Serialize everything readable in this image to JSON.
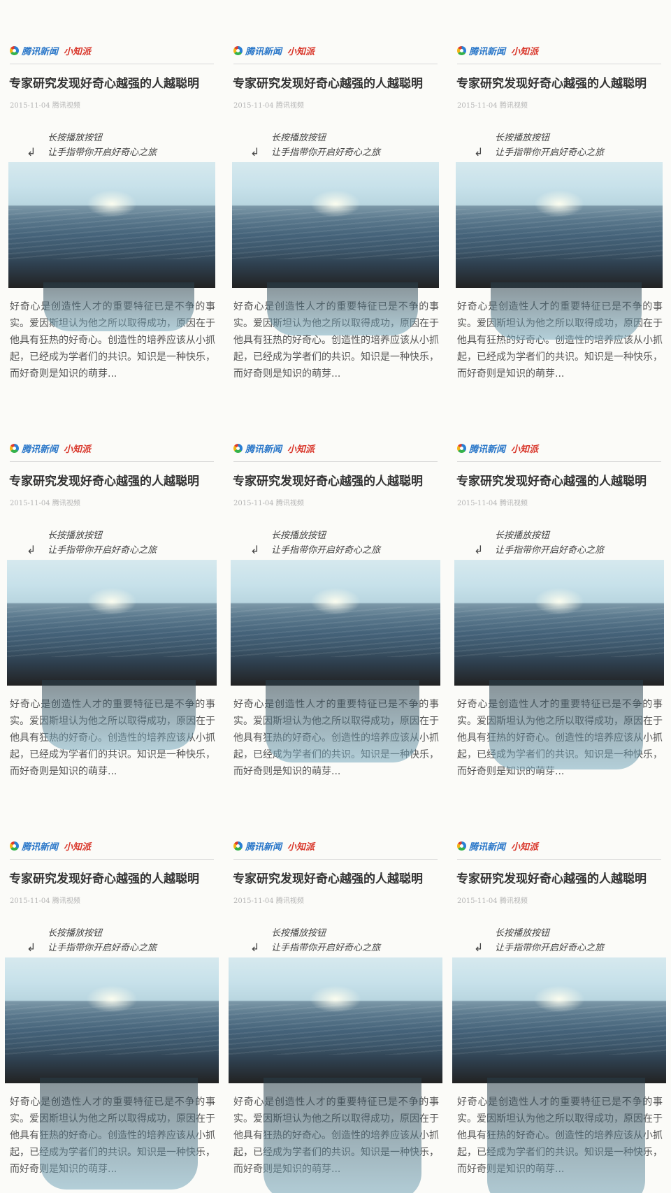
{
  "panels": [
    {
      "brand": "腾讯新闻",
      "tag": "小知派",
      "title": "专家研究发现好奇心越强的人越聪明",
      "meta": "2015-11-04 腾讯视频",
      "hint_line1": "长按播放按钮",
      "hint_line2": "让手指带你开启好奇心之旅",
      "article": "好奇心是创造性人才的重要特征已是不争的事实。爱因斯坦认为他之所以取得成功，原因在于他具有狂热的好奇心。创造性的培养应该从小抓起，已经成为学者们的共识。知识是一种快乐，而好奇则是知识的萌芽..."
    },
    {
      "brand": "腾讯新闻",
      "tag": "小知派",
      "title": "专家研究发现好奇心越强的人越聪明",
      "meta": "2015-11-04 腾讯视频",
      "hint_line1": "长按播放按钮",
      "hint_line2": "让手指带你开启好奇心之旅",
      "article": "好奇心是创造性人才的重要特征已是不争的事实。爱因斯坦认为他之所以取得成功，原因在于他具有狂热的好奇心。创造性的培养应该从小抓起，已经成为学者们的共识。知识是一种快乐，而好奇则是知识的萌芽..."
    },
    {
      "brand": "腾讯新闻",
      "tag": "小知派",
      "title": "专家研究发现好奇心越强的人越聪明",
      "meta": "2015-11-04 腾讯视频",
      "hint_line1": "长按播放按钮",
      "hint_line2": "让手指带你开启好奇心之旅",
      "article": "好奇心是创造性人才的重要特征已是不争的事实。爱因斯坦认为他之所以取得成功，原因在于他具有狂热的好奇心。创造性的培养应该从小抓起，已经成为学者们的共识。知识是一种快乐，而好奇则是知识的萌芽..."
    },
    {
      "brand": "腾讯新闻",
      "tag": "小知派",
      "title": "专家研究发现好奇心越强的人越聪明",
      "meta": "2015-11-04 腾讯视频",
      "hint_line1": "长按播放按钮",
      "hint_line2": "让手指带你开启好奇心之旅",
      "article": "好奇心是创造性人才的重要特征已是不争的事实。爱因斯坦认为他之所以取得成功，原因在于他具有狂热的好奇心。创造性的培养应该从小抓起，已经成为学者们的共识。知识是一种快乐，而好奇则是知识的萌芽..."
    },
    {
      "brand": "腾讯新闻",
      "tag": "小知派",
      "title": "专家研究发现好奇心越强的人越聪明",
      "meta": "2015-11-04 腾讯视频",
      "hint_line1": "长按播放按钮",
      "hint_line2": "让手指带你开启好奇心之旅",
      "article": "好奇心是创造性人才的重要特征已是不争的事实。爱因斯坦认为他之所以取得成功，原因在于他具有狂热的好奇心。创造性的培养应该从小抓起，已经成为学者们的共识。知识是一种快乐，而好奇则是知识的萌芽..."
    },
    {
      "brand": "腾讯新闻",
      "tag": "小知派",
      "title": "专家研究发现好奇心越强的人越聪明",
      "meta": "2015-11-04 腾讯视频",
      "hint_line1": "长按播放按钮",
      "hint_line2": "让手指带你开启好奇心之旅",
      "article": "好奇心是创造性人才的重要特征已是不争的事实。爱因斯坦认为他之所以取得成功，原因在于他具有狂热的好奇心。创造性的培养应该从小抓起，已经成为学者们的共识。知识是一种快乐，而好奇则是知识的萌芽..."
    },
    {
      "brand": "腾讯新闻",
      "tag": "小知派",
      "title": "专家研究发现好奇心越强的人越聪明",
      "meta": "2015-11-04 腾讯视频",
      "hint_line1": "长按播放按钮",
      "hint_line2": "让手指带你开启好奇心之旅",
      "article": "好奇心是创造性人才的重要特征已是不争的事实。爱因斯坦认为他之所以取得成功，原因在于他具有狂热的好奇心。创造性的培养应该从小抓起，已经成为学者们的共识。知识是一种快乐，而好奇则是知识的萌芽..."
    },
    {
      "brand": "腾讯新闻",
      "tag": "小知派",
      "title": "专家研究发现好奇心越强的人越聪明",
      "meta": "2015-11-04 腾讯视频",
      "hint_line1": "长按播放按钮",
      "hint_line2": "让手指带你开启好奇心之旅",
      "article": "好奇心是创造性人才的重要特征已是不争的事实。爱因斯坦认为他之所以取得成功，原因在于他具有狂热的好奇心。创造性的培养应该从小抓起，已经成为学者们的共识。知识是一种快乐，而好奇则是知识的萌芽..."
    },
    {
      "brand": "腾讯新闻",
      "tag": "小知派",
      "title": "专家研究发现好奇心越强的人越聪明",
      "meta": "2015-11-04 腾讯视频",
      "hint_line1": "长按播放按钮",
      "hint_line2": "让手指带你开启好奇心之旅",
      "article": "好奇心是创造性人才的重要特征已是不争的事实。爱因斯坦认为他之所以取得成功，原因在于他具有狂热的好奇心。创造性的培养应该从小抓起，已经成为学者们的共识。知识是一种快乐，而好奇则是知识的萌芽..."
    }
  ],
  "colors": {
    "brand_blue": "#2a77c9",
    "brand_red": "#d9362a",
    "ocean_dark": "#2e3f4e",
    "sky_light": "#d6e9ee"
  },
  "icons": {
    "logo": "tencent-news-logo-icon",
    "hint_arrow": "curved-arrow-icon"
  }
}
